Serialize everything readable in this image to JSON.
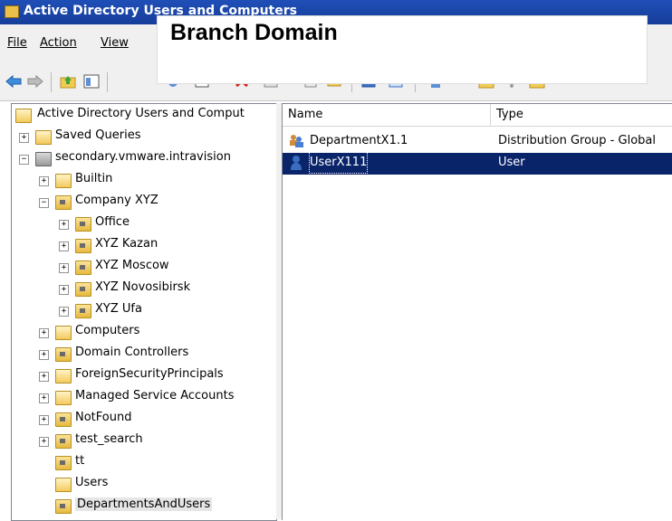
{
  "window": {
    "title": "Active Directory Users and Computers"
  },
  "overlay": {
    "text": "Branch Domain"
  },
  "menu": {
    "items": [
      "File",
      "Action",
      "View"
    ]
  },
  "tree": {
    "root": "Active Directory Users and Comput",
    "saved_queries": "Saved Queries",
    "domain": "secondary.vmware.intravision",
    "builtin": "Builtin",
    "company": "Company XYZ",
    "company_children": [
      "Office",
      "XYZ Kazan",
      "XYZ Moscow",
      "XYZ Novosibirsk",
      "XYZ Ufa"
    ],
    "computers": "Computers",
    "domain_controllers": "Domain Controllers",
    "fsp": "ForeignSecurityPrincipals",
    "msa": "Managed Service Accounts",
    "notfound": "NotFound",
    "test_search": "test_search",
    "tt": "tt",
    "users": "Users",
    "deps": "DepartmentsAndUsers",
    "expand_plus": "+",
    "expand_minus": "−"
  },
  "list": {
    "columns": [
      "Name",
      "Type"
    ],
    "rows": [
      {
        "name": "DepartmentX1.1",
        "type": "Distribution Group - Global",
        "icon": "group-icon"
      },
      {
        "name": "UserX111",
        "type": "User",
        "icon": "user-icon",
        "selected": true
      }
    ]
  }
}
